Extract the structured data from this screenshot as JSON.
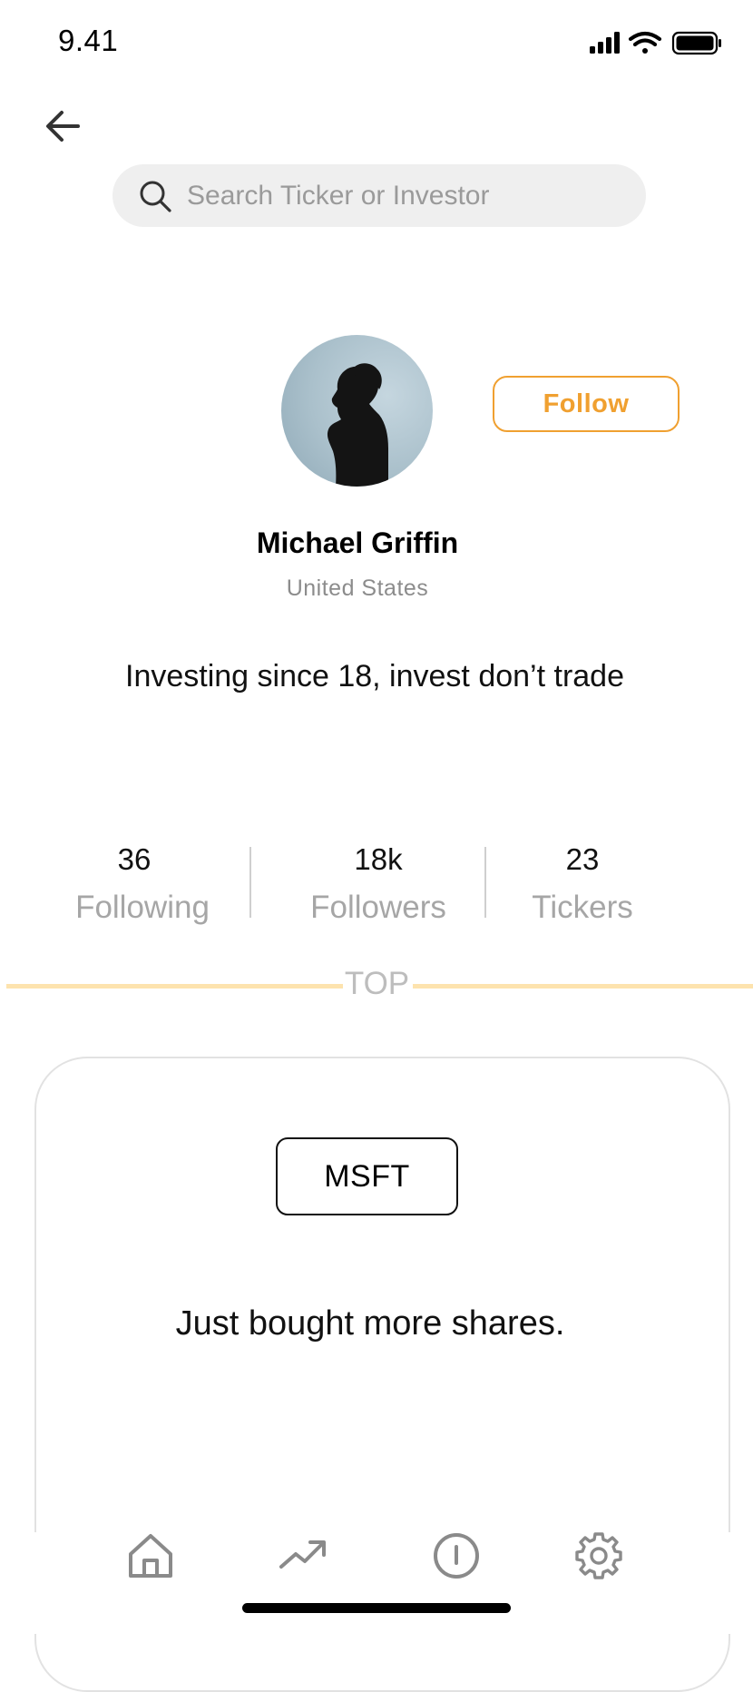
{
  "status_bar": {
    "time": "9.41",
    "icons": [
      "cellular-signal-icon",
      "wifi-icon",
      "battery-icon"
    ]
  },
  "nav": {
    "back_icon": "back-arrow-icon"
  },
  "search": {
    "placeholder": "Search Ticker or Investor",
    "value": "",
    "icon": "search-icon"
  },
  "profile": {
    "name": "Michael Griffin",
    "country": "United States",
    "bio": "Investing since 18, invest don’t trade",
    "follow_label": "Follow"
  },
  "stats": [
    {
      "value": "36",
      "label": "Following"
    },
    {
      "value": "18k",
      "label": "Followers"
    },
    {
      "value": "23",
      "label": "Tickers"
    }
  ],
  "section": {
    "label": "TOP"
  },
  "post": {
    "ticker": "MSFT",
    "text": "Just bought more shares."
  },
  "tabbar": {
    "items": [
      "home-icon",
      "trending-icon",
      "info-icon",
      "settings-icon"
    ]
  },
  "colors": {
    "accent": "#f0a030",
    "separator": "#fde3ae",
    "muted_text": "#a6a6a6",
    "search_bg": "#efefef"
  }
}
